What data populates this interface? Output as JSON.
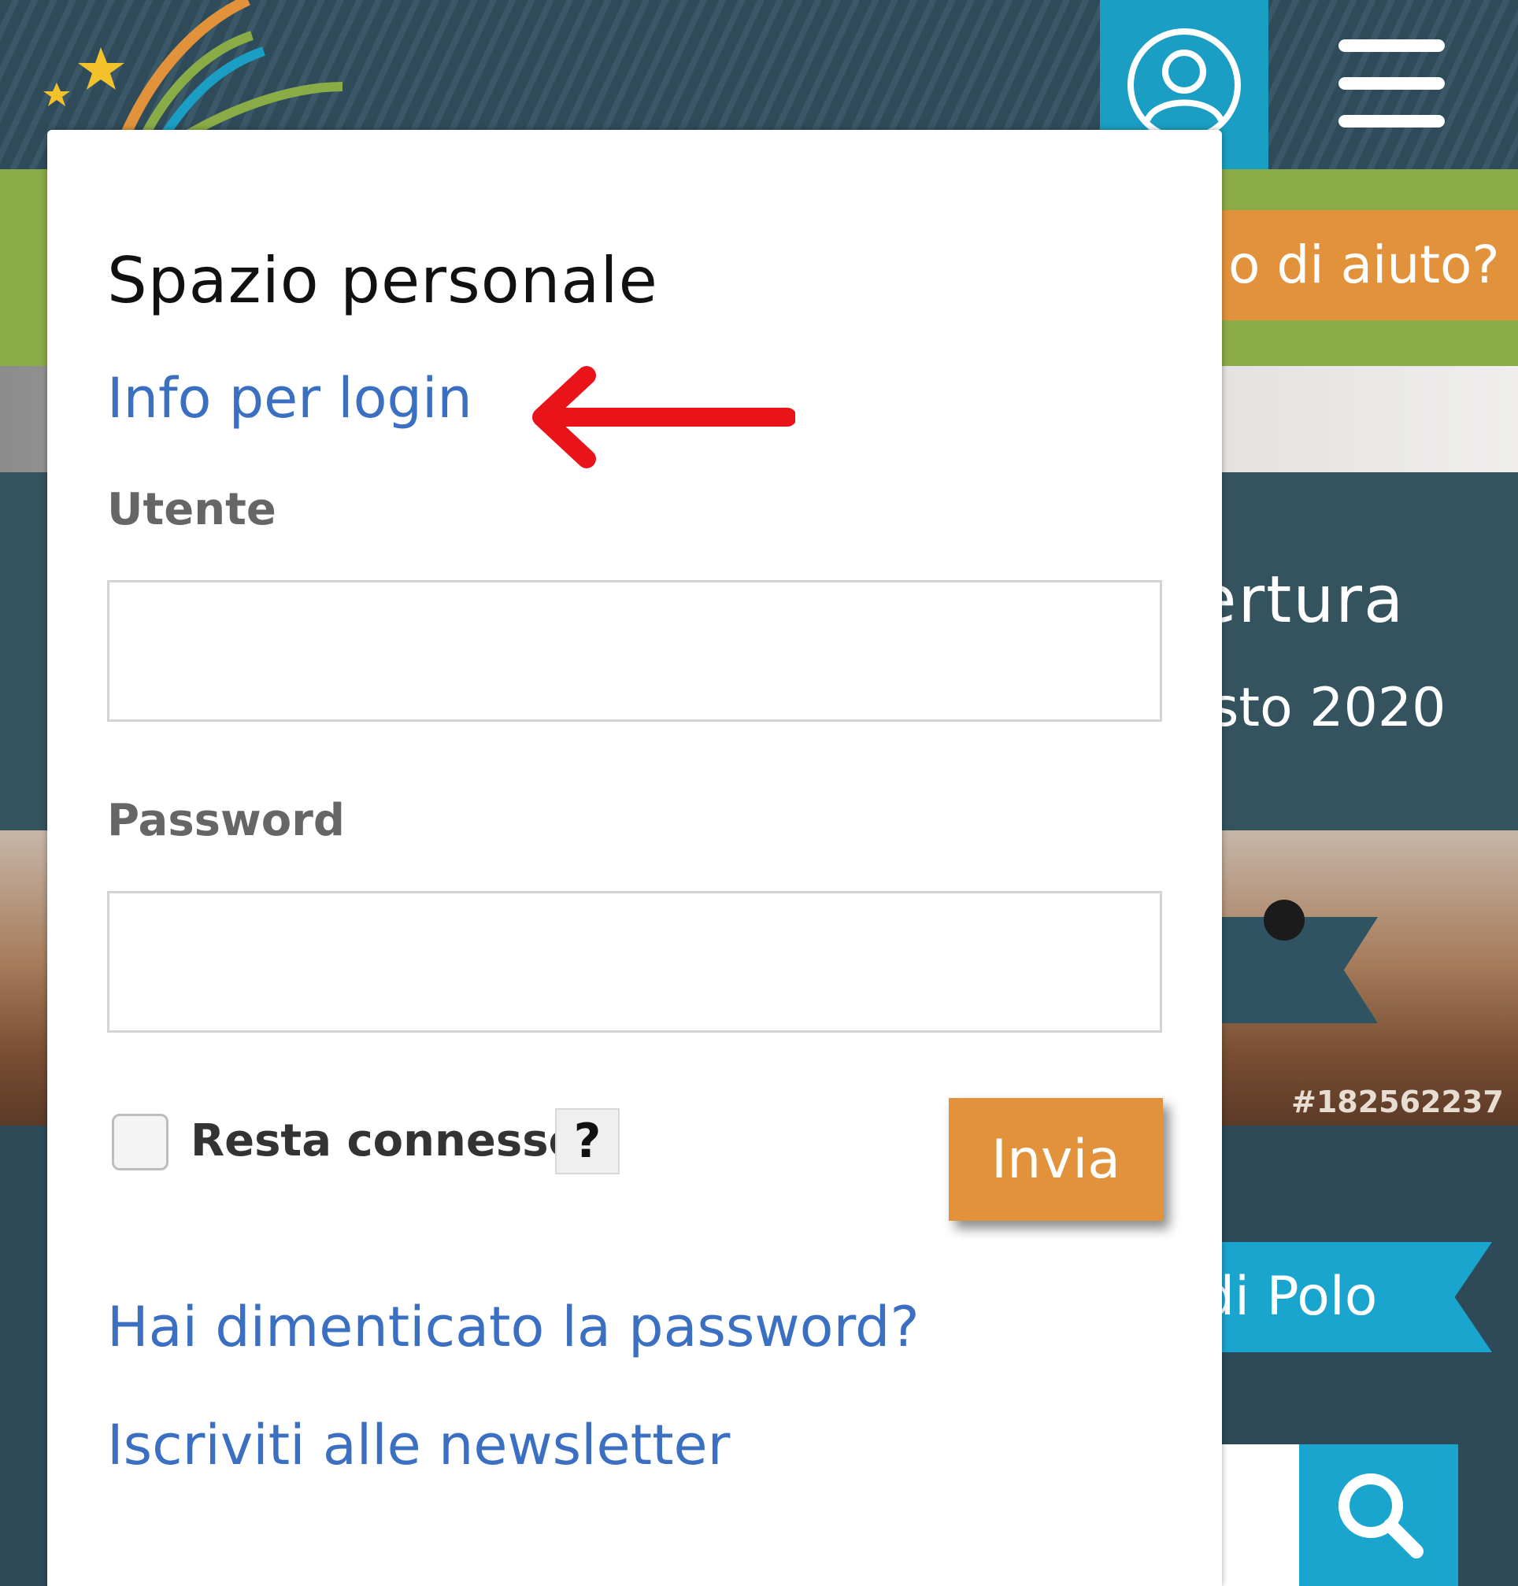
{
  "header": {
    "user_icon": "user-circle-icon",
    "menu_icon": "hamburger-icon"
  },
  "background": {
    "help_button": "o di aiuto?",
    "hero_title": "ertura",
    "hero_subtitle": "sto 2020",
    "photo_id": "#182562237",
    "polo_ribbon": "di Polo",
    "search_icon": "search-icon"
  },
  "login": {
    "title": "Spazio personale",
    "info_link": "Info per login",
    "username_label": "Utente",
    "username_value": "",
    "password_label": "Password",
    "password_value": "",
    "remember_label": "Resta connesso",
    "remember_checked": false,
    "help_button": "?",
    "submit_label": "Invia",
    "forgot_link": "Hai dimenticato la password?",
    "newsletter_link": "Iscriviti alle newsletter"
  },
  "colors": {
    "accent_orange": "#e2923a",
    "link_blue": "#3b6fc1",
    "header_teal": "#1a9ec4",
    "annotation_red": "#e8141a"
  }
}
